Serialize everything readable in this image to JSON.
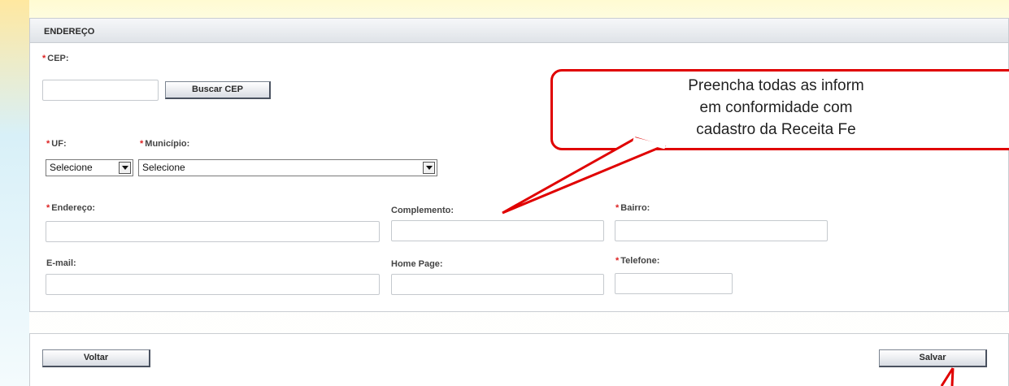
{
  "section": {
    "title": "ENDEREÇO"
  },
  "cep": {
    "label": "CEP:",
    "value": "",
    "button_label": "Buscar CEP"
  },
  "uf": {
    "label": "UF:",
    "selected": "Selecione"
  },
  "municipio": {
    "label": "Município:",
    "selected": "Selecione"
  },
  "endereco": {
    "label": "Endereço:",
    "value": ""
  },
  "complemento": {
    "label": "Complemento:",
    "value": ""
  },
  "bairro": {
    "label": "Bairro:",
    "value": ""
  },
  "email": {
    "label": "E-mail:",
    "value": ""
  },
  "homepage": {
    "label": "Home Page:",
    "value": ""
  },
  "telefone": {
    "label": "Telefone:",
    "value": ""
  },
  "required_marker": "*",
  "actions": {
    "back_label": "Voltar",
    "save_label": "Salvar"
  },
  "callout": {
    "lines": [
      "Preencha todas as inform",
      "em conformidade com",
      "cadastro da Receita Fe"
    ]
  },
  "colors": {
    "callout_border": "#e00000",
    "required": "#dd2222"
  }
}
